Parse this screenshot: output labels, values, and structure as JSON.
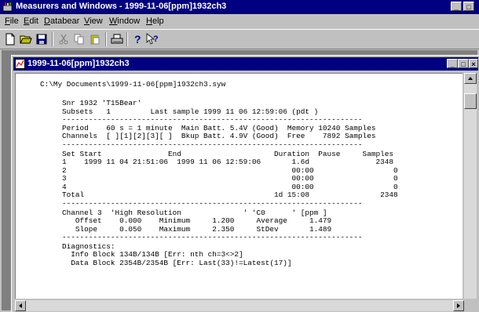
{
  "app": {
    "title": "Measurers and Windows - 1999-11-06[ppm]1932ch3",
    "window_buttons": {
      "minimize": "_",
      "maximize": "□"
    }
  },
  "menu": {
    "items": [
      {
        "key": "F",
        "rest": "ile"
      },
      {
        "key": "E",
        "rest": "dit"
      },
      {
        "key": "D",
        "rest": "atabear"
      },
      {
        "key": "V",
        "rest": "iew"
      },
      {
        "key": "W",
        "rest": "indow"
      },
      {
        "key": "H",
        "rest": "elp"
      }
    ]
  },
  "toolbar": {
    "icons": [
      "new-file-icon",
      "open-folder-icon",
      "save-disk-icon",
      "cut-icon",
      "copy-icon",
      "paste-icon",
      "print-icon",
      "help-icon",
      "context-help-icon"
    ]
  },
  "document_window": {
    "title": "1999-11-06[ppm]1932ch3",
    "buttons": {
      "minimize": "_",
      "maximize": "□",
      "close": "×"
    }
  },
  "report": {
    "path": "C:\\My Documents\\1999-11-06[ppm]1932ch3.syw",
    "header": [
      "Snr 1932 'T15Bear'",
      "Subsets   1         Last sample 1999 11 06 12:59:06 (pdt )"
    ],
    "divider": "--------------------------------------------------------------------",
    "period_lines": [
      "Period    60 s = 1 minute  Main Batt. 5.4V (Good)  Memory 10240 Samples",
      "Channels  [ ][1][2][3][ ]  Bkup Batt. 4.9V (Good)  Free    7892 Samples"
    ],
    "sets_lines": [
      "Set Start               End                     Duration  Pause     Samples",
      "1    1999 11 04 21:51:06  1999 11 06 12:59:06       1.6d               2348",
      "2                                                   00:00                  0",
      "3                                                   00:00                  0",
      "4                                                   00:00                  0",
      "Total                                           1d 15:08                2348"
    ],
    "channel_lines": [
      "Channel 3  'High Resolution              ' 'C0      ' [ppm ]",
      "   Offset    0.000    Minimum     1.200     Average     1.479",
      "   Slope     0.050    Maximum     2.350     StDev       1.489"
    ],
    "diagnostics_lines": [
      "Diagnostics:",
      "  Info Block 134B/134B [Err: nth ch=3<>2]",
      "  Data Block 2354B/2354B [Err: Last(33)!=Latest(17)]"
    ]
  },
  "colors": {
    "titlebar": "#000080",
    "face": "#c0c0c0",
    "mdi_background": "#808080",
    "document": "#ffffff"
  }
}
